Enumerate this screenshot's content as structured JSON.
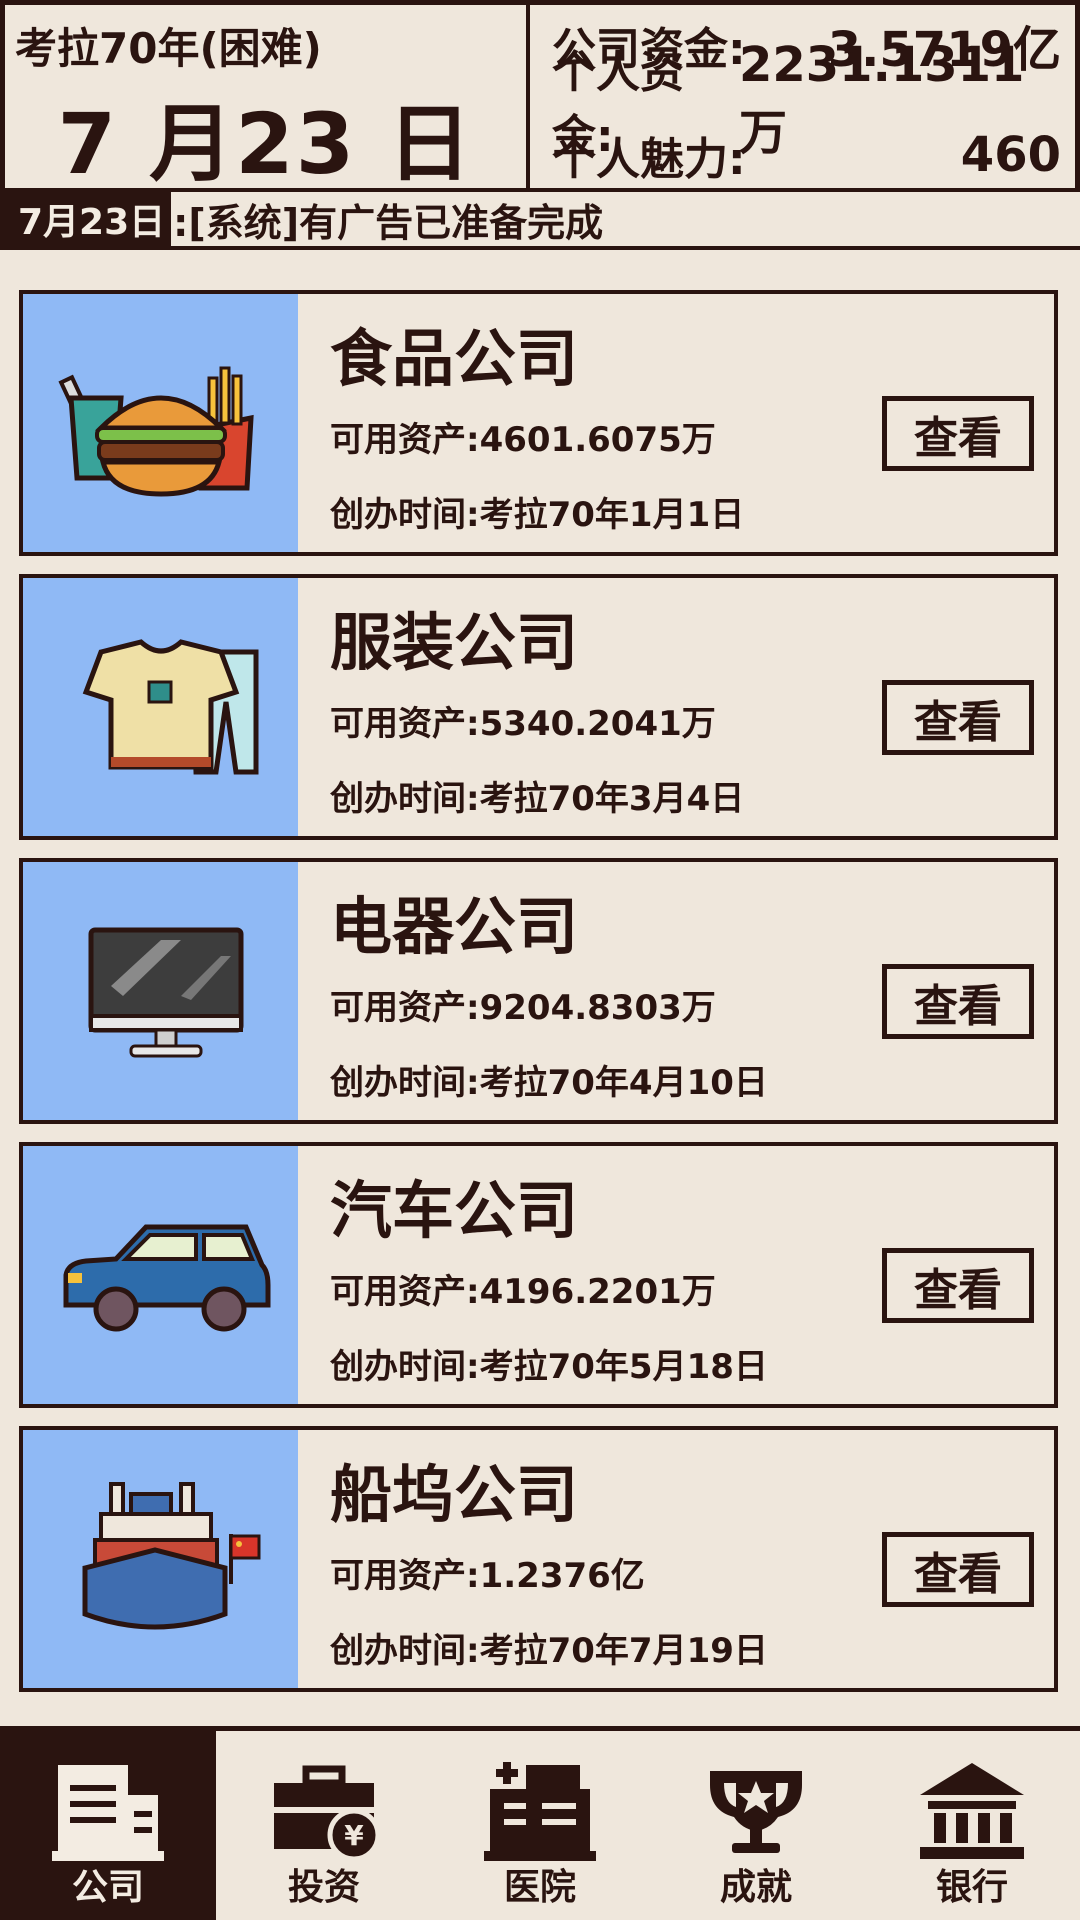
{
  "header": {
    "year_label": "考拉70年(困难)",
    "date": "7 月23 日",
    "stats": [
      {
        "label": "公司资金:",
        "value": "3.5719亿"
      },
      {
        "label": "个人资金:",
        "value": "2231.1311万"
      },
      {
        "label": "个人魅力:",
        "value": "460"
      }
    ]
  },
  "message": {
    "date": "7月23日",
    "text": ":[系统]有广告已准备完成"
  },
  "companies": [
    {
      "name": "食品公司",
      "asset": "可用资产:4601.6075万",
      "founded": "创办时间:考拉70年1月1日",
      "button": "查看",
      "icon": "food-icon"
    },
    {
      "name": "服装公司",
      "asset": "可用资产:5340.2041万",
      "founded": "创办时间:考拉70年3月4日",
      "button": "查看",
      "icon": "clothing-icon"
    },
    {
      "name": "电器公司",
      "asset": "可用资产:9204.8303万",
      "founded": "创办时间:考拉70年4月10日",
      "button": "查看",
      "icon": "monitor-icon"
    },
    {
      "name": "汽车公司",
      "asset": "可用资产:4196.2201万",
      "founded": "创办时间:考拉70年5月18日",
      "button": "查看",
      "icon": "car-icon"
    },
    {
      "name": "船坞公司",
      "asset": "可用资产:1.2376亿",
      "founded": "创办时间:考拉70年7月19日",
      "button": "查看",
      "icon": "ship-icon"
    }
  ],
  "nav": [
    {
      "label": "公司",
      "icon": "building-icon",
      "active": true
    },
    {
      "label": "投资",
      "icon": "briefcase-yen-icon",
      "active": false
    },
    {
      "label": "医院",
      "icon": "hospital-icon",
      "active": false
    },
    {
      "label": "成就",
      "icon": "trophy-icon",
      "active": false
    },
    {
      "label": "银行",
      "icon": "bank-icon",
      "active": false
    }
  ],
  "colors": {
    "background": "#efe7dc",
    "ink": "#2a1410",
    "card_image_bg": "#8fb9f5"
  }
}
